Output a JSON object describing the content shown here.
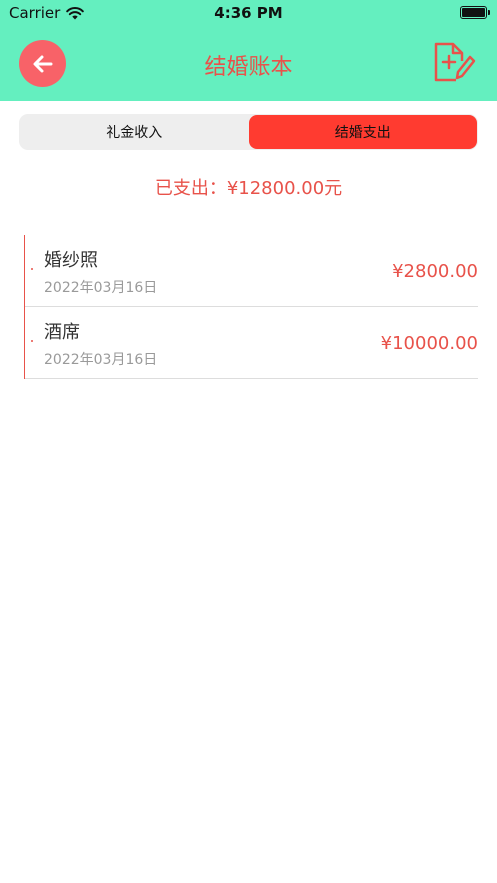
{
  "status_bar": {
    "carrier": "Carrier",
    "time": "4:36 PM"
  },
  "nav": {
    "title": "结婚账本",
    "back_icon": "arrow-left-icon",
    "add_icon": "document-add-edit-icon"
  },
  "tabs": [
    {
      "label": "礼金收入",
      "active": false
    },
    {
      "label": "结婚支出",
      "active": true
    }
  ],
  "summary": {
    "spent_text": "已支出：¥12800.00元"
  },
  "records": [
    {
      "name": "婚纱照",
      "date": "2022年03月16日",
      "amount": "¥2800.00"
    },
    {
      "name": "酒席",
      "date": "2022年03月16日",
      "amount": "¥10000.00"
    }
  ],
  "colors": {
    "header_bg": "#64efbf",
    "accent_red": "#e8524a",
    "active_tab": "#ff3b30",
    "back_button": "#f86268"
  }
}
